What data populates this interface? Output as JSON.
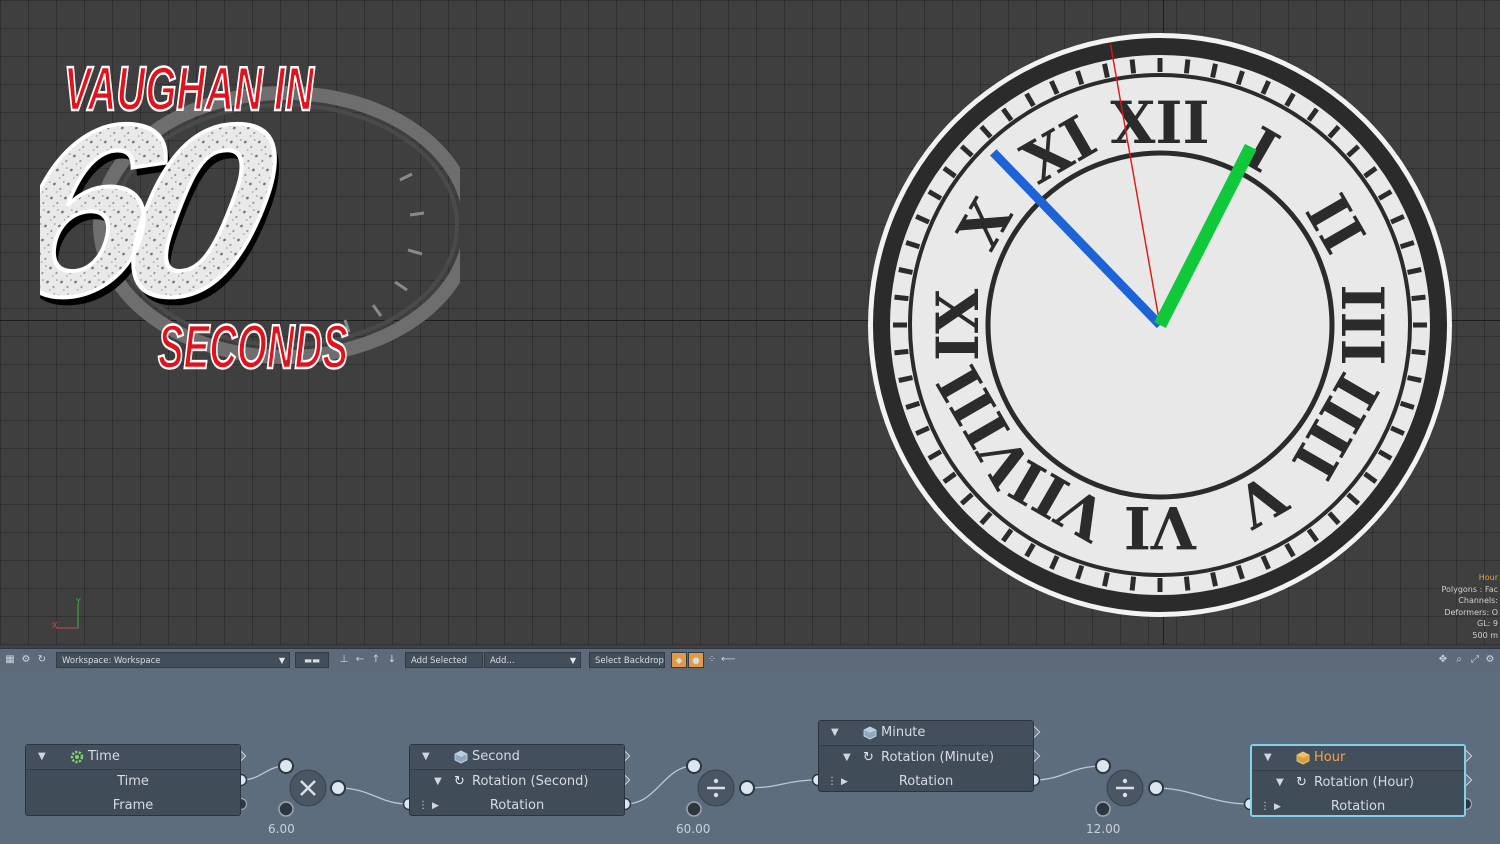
{
  "logo": {
    "line1": "VAUGHAN IN",
    "number": "60",
    "line2": "SECONDS"
  },
  "viewport": {
    "info_lines": [
      "Hour",
      "Polygons : Fac",
      "Channels:",
      "Deformers: O",
      "GL: 9",
      "500 m"
    ]
  },
  "toolbar": {
    "workspace_label": "Workspace: Workspace",
    "add_selected_label": "Add Selected",
    "add_label": "Add...",
    "select_backdrop_label": "Select Backdrop"
  },
  "nodes": {
    "time": {
      "title": "Time",
      "channels": [
        "Time",
        "Frame"
      ]
    },
    "second": {
      "title": "Second",
      "sub": "Rotation (Second)",
      "channel": "Rotation"
    },
    "minute": {
      "title": "Minute",
      "sub": "Rotation (Minute)",
      "channel": "Rotation"
    },
    "hour": {
      "title": "Hour",
      "sub": "Rotation (Hour)",
      "channel": "Rotation"
    }
  },
  "operators": [
    {
      "type": "multiply",
      "value": "6.00"
    },
    {
      "type": "divide",
      "value": "60.00"
    },
    {
      "type": "divide",
      "value": "12.00"
    }
  ],
  "colors": {
    "hour_hand": "#1d63d8",
    "minute_hand": "#10c93a",
    "second_hand": "#e01414",
    "selected_node_border": "#7fd2e8",
    "highlight_text": "#f2a93a",
    "logo_red": "#e3111b"
  },
  "icons": [
    "group-icon",
    "gear-icon",
    "refresh-icon",
    "grid-icon",
    "hierarchy-icon",
    "arrow-left-icon",
    "arrow-up-icon",
    "arrow-down-icon",
    "move-icon",
    "zoom-icon",
    "fit-icon",
    "settings-icon",
    "cube-icon",
    "rotation-icon",
    "clock-gear-icon"
  ]
}
